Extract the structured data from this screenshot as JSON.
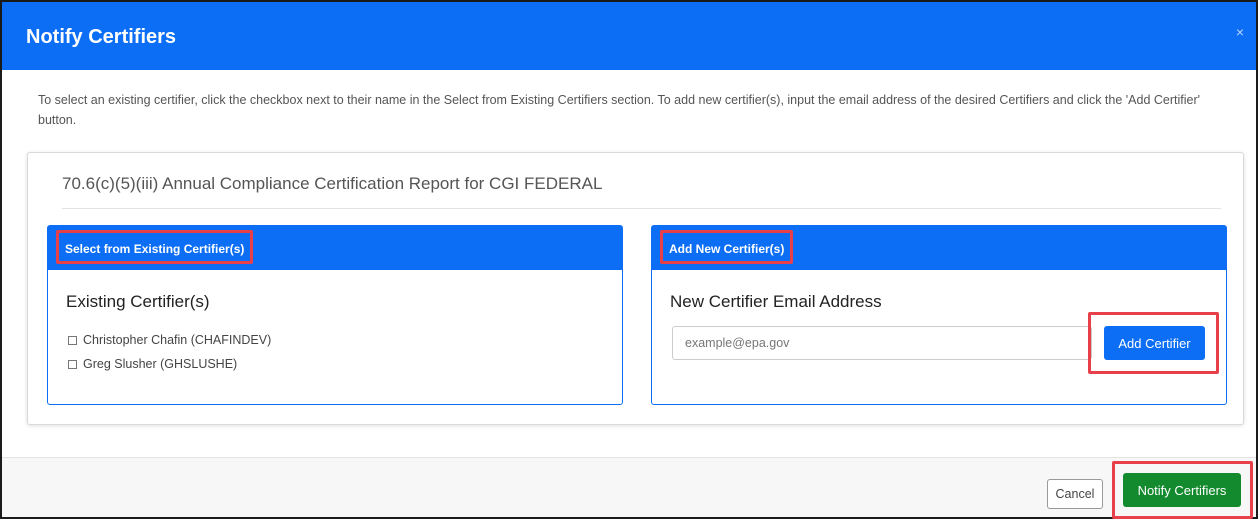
{
  "dialog": {
    "title": "Notify Certifiers",
    "close_glyph": "×",
    "instructions": "To select an existing certifier, click the checkbox next to their name in the Select from Existing Certifiers section. To add new certifier(s), input the email address of the desired Certifiers and click the 'Add Certifier' button."
  },
  "report": {
    "title": "70.6(c)(5)(iii) Annual Compliance Certification Report for CGI FEDERAL"
  },
  "existing_panel": {
    "header": "Select from Existing Certifier(s)",
    "subheading": "Existing Certifier(s)",
    "certifiers": [
      {
        "label": "Christopher Chafin (CHAFINDEV)",
        "checked": false
      },
      {
        "label": "Greg Slusher (GHSLUSHE)",
        "checked": false
      }
    ]
  },
  "new_panel": {
    "header": "Add New Certifier(s)",
    "subheading": "New Certifier Email Address",
    "email_value": "",
    "email_placeholder": "example@epa.gov",
    "add_button": "Add Certifier"
  },
  "footer": {
    "cancel_button": "Cancel",
    "notify_button": "Notify Certifiers"
  },
  "colors": {
    "primary": "#0b6ef5",
    "success": "#138a2e",
    "highlight": "#e8404a"
  }
}
